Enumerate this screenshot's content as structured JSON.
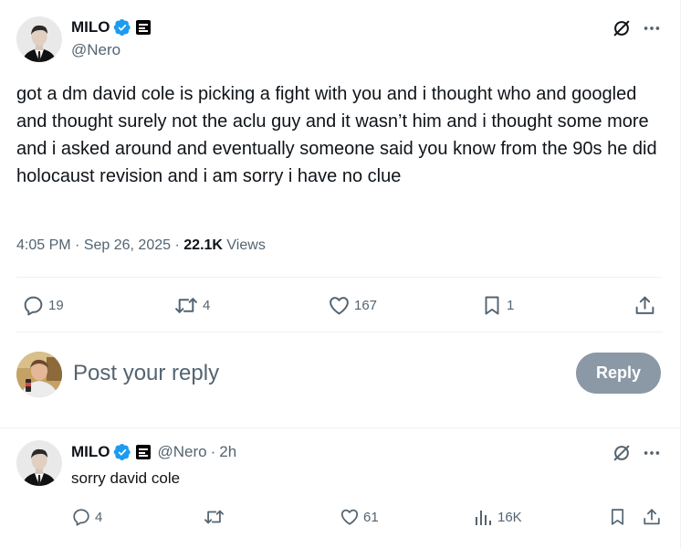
{
  "main_tweet": {
    "display_name": "MILO",
    "handle": "@Nero",
    "text": "got a dm david cole is picking a fight with you and i thought who and googled and thought surely not the aclu guy and it wasn’t him and i thought some more and i asked around and eventually someone said you know from the 90s he did holocaust revision and i am sorry i have no clue",
    "time": "4:05 PM",
    "date": "Sep 26, 2025",
    "views_count": "22.1K",
    "views_label": "Views",
    "replies": "19",
    "reposts": "4",
    "likes": "167",
    "bookmarks": "1"
  },
  "composer": {
    "placeholder": "Post your reply",
    "button_label": "Reply"
  },
  "reply_tweet": {
    "display_name": "MILO",
    "handle": "@Nero",
    "separator": "·",
    "age": "2h",
    "text": "sorry david cole",
    "replies": "4",
    "reposts": "",
    "likes": "61",
    "views": "16K"
  },
  "icons": [
    "verified-badge-icon",
    "affiliate-badge-icon",
    "grok-icon",
    "more-icon",
    "reply-icon",
    "repost-icon",
    "like-icon",
    "bookmark-icon",
    "share-icon",
    "views-icon"
  ],
  "colors": {
    "verified": "#1d9bf0",
    "secondary_text": "#536471",
    "reply_button": "#8b98a5",
    "divider": "#eff3f4"
  }
}
